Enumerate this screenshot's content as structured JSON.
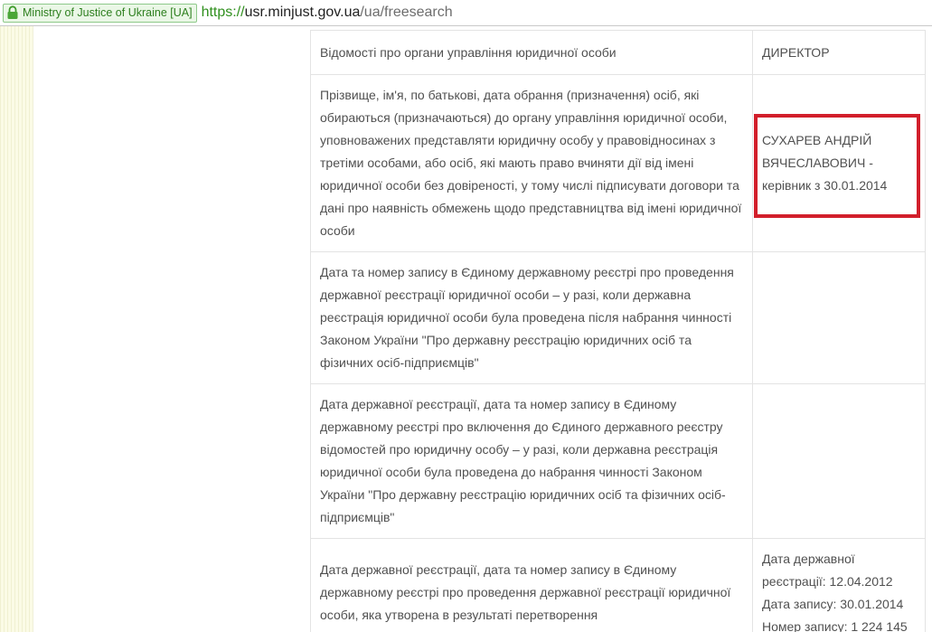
{
  "browser": {
    "site_identity": "Ministry of Justice of Ukraine [UA]",
    "url_scheme": "https://",
    "url_host": "usr.minjust.gov.ua",
    "url_path": "/ua/freesearch"
  },
  "table": {
    "rows": [
      {
        "label": "Відомості про органи управління юридичної особи",
        "value_lines": [
          "ДИРЕКТОР"
        ]
      },
      {
        "label": "Прізвище, ім'я, по батькові, дата обрання (призначення) осіб, які обираються (призначаються) до органу управління юридичної особи, уповноважених представляти юридичну особу у правовідносинах з третіми особами, або осіб, які мають право вчиняти дії від імені юридичної особи без довіреності, у тому числі підписувати договори та дані про наявність обмежень щодо представництва від імені юридичної особи",
        "value_lines": [
          "СУХАРЕВ АНДРІЙ ВЯЧЕСЛАВОВИЧ - керівник з 30.01.2014"
        ]
      },
      {
        "label": "Дата та номер запису в Єдиному державному реєстрі про проведення державної реєстрації юридичної особи – у разі, коли державна реєстрація юридичної особи була проведена після набрання чинності Законом України \"Про державну реєстрацію юридичних осіб та фізичних осіб-підприємців\"",
        "value_lines": []
      },
      {
        "label": "Дата державної реєстрації, дата та номер запису в Єдиному державному реєстрі про включення до Єдиного державного реєстру відомостей про юридичну особу – у разі, коли державна реєстрація юридичної особи була проведена до набрання чинності Законом України \"Про державну реєстрацію юридичних осіб та фізичних осіб-підприємців\"",
        "value_lines": []
      },
      {
        "label": "Дата державної реєстрації, дата та номер запису в Єдиному державному реєстрі про проведення державної реєстрації юридичної особи, яка утворена в результаті перетворення",
        "value_lines": [
          "Дата державної реєстрації: 12.04.2012",
          "Дата запису: 30.01.2014",
          "Номер запису: 1 224 145"
        ]
      }
    ]
  },
  "colors": {
    "highlight": "#d21f2b",
    "secure_green": "#2f8f1d"
  },
  "icons": {
    "site_identity": "lock-icon"
  }
}
